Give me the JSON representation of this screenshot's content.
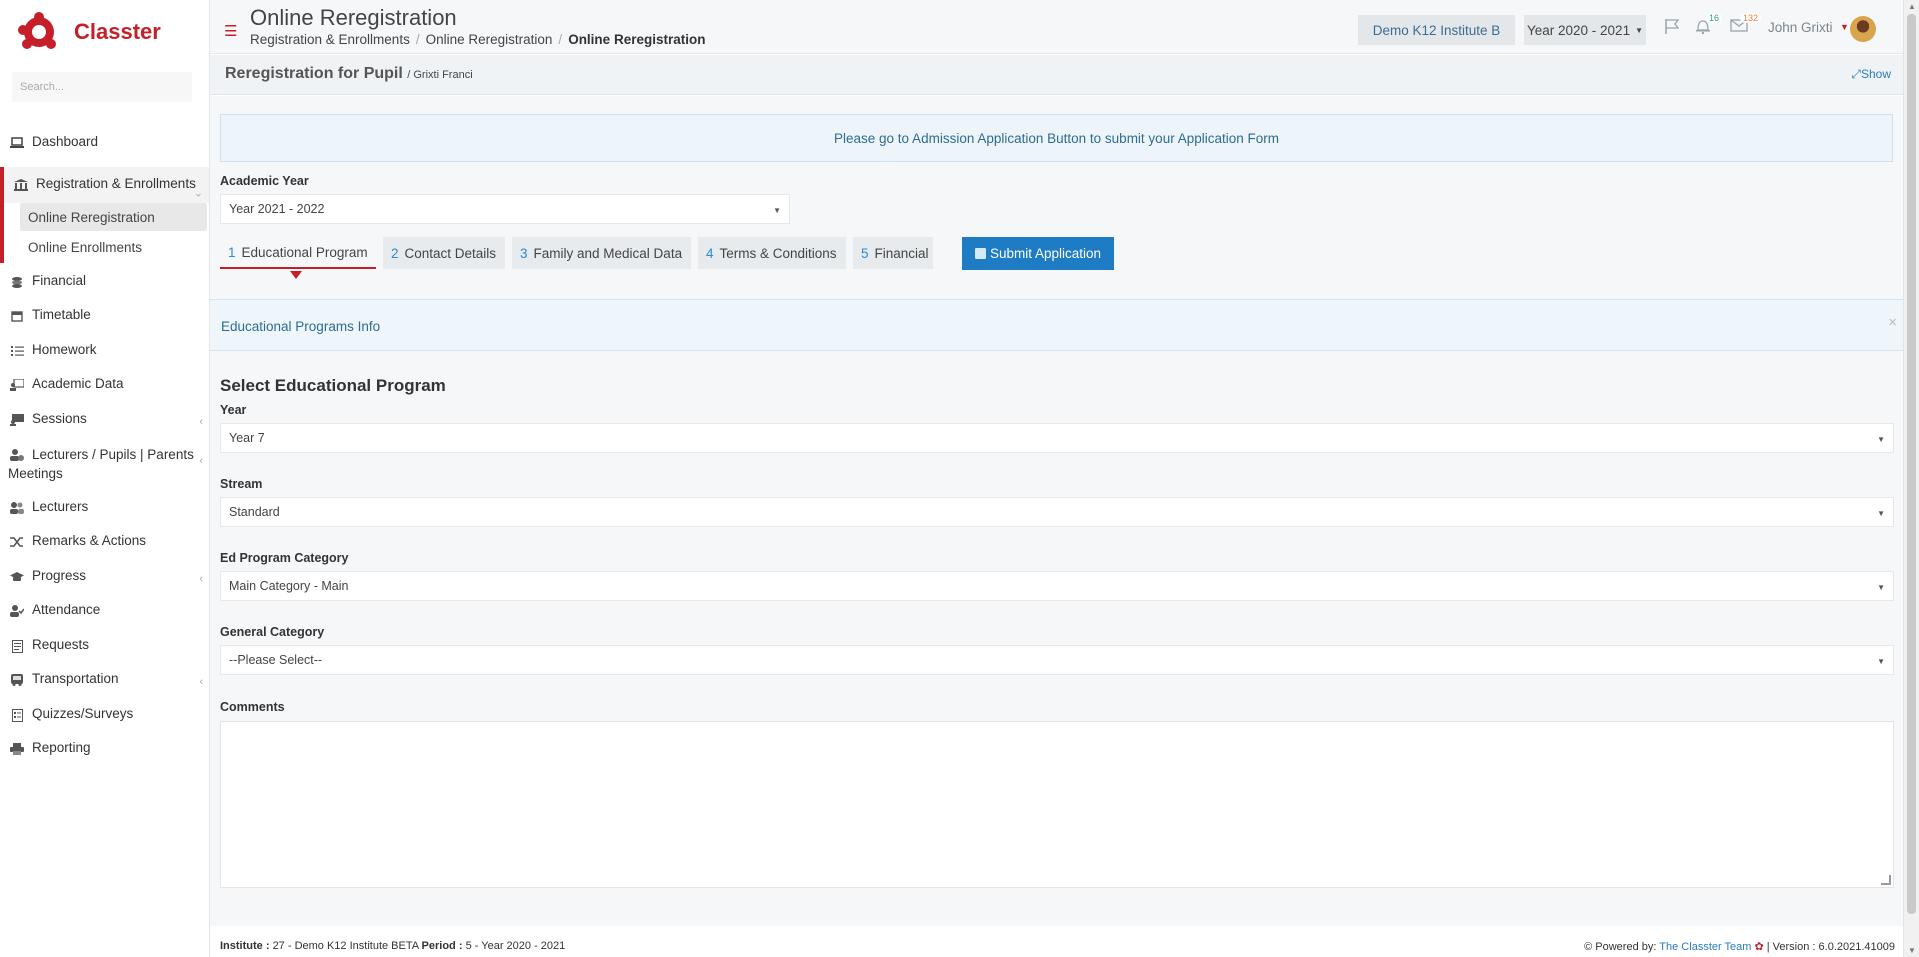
{
  "app": {
    "name": "Classter"
  },
  "sidebar": {
    "search_placeholder": "Search...",
    "items": [
      {
        "label": "Dashboard",
        "icon": "laptop-icon"
      },
      {
        "label": "Registration & Enrollments",
        "icon": "institution-icon"
      },
      {
        "label": "Financial",
        "icon": "coins-icon"
      },
      {
        "label": "Timetable",
        "icon": "calendar-icon"
      },
      {
        "label": "Homework",
        "icon": "list-icon"
      },
      {
        "label": "Academic Data",
        "icon": "chalkboard-user-icon"
      },
      {
        "label": "Sessions",
        "icon": "presentation-icon"
      },
      {
        "label": "Lecturers / Pupils | Parents Meetings",
        "icon": "user-clock-icon"
      },
      {
        "label": "Lecturers",
        "icon": "users-icon"
      },
      {
        "label": "Remarks & Actions",
        "icon": "shuffle-icon"
      },
      {
        "label": "Progress",
        "icon": "graduation-cap-icon"
      },
      {
        "label": "Attendance",
        "icon": "user-check-icon"
      },
      {
        "label": "Requests",
        "icon": "document-icon"
      },
      {
        "label": "Transportation",
        "icon": "bus-icon"
      },
      {
        "label": "Quizzes/Surveys",
        "icon": "checklist-icon"
      },
      {
        "label": "Reporting",
        "icon": "printer-icon"
      }
    ],
    "subitems": [
      {
        "label": "Online Reregistration"
      },
      {
        "label": "Online Enrollments"
      }
    ]
  },
  "header": {
    "title": "Online Reregistration",
    "breadcrumb": [
      "Registration & Enrollments",
      "Online Reregistration",
      "Online Reregistration"
    ],
    "institute": "Demo K12 Institute B",
    "year": "Year 2020 - 2021",
    "notifications_count": "16",
    "messages_count": "132",
    "user_name": "John Grixti"
  },
  "subheader": {
    "title": "Reregistration for Pupil",
    "pupil": "/ Grixti Franci",
    "show_label": "Show"
  },
  "main": {
    "info_alert": "Please go to Admission Application Button to submit your Application Form",
    "academic_year_label": "Academic Year",
    "academic_year_value": "Year 2021 - 2022",
    "tabs": [
      {
        "num": "1",
        "label": "Educational Program"
      },
      {
        "num": "2",
        "label": "Contact Details"
      },
      {
        "num": "3",
        "label": "Family and Medical Data"
      },
      {
        "num": "4",
        "label": "Terms & Conditions"
      },
      {
        "num": "5",
        "label": "Financial"
      }
    ],
    "submit_label": "Submit Application",
    "ed_info": "Educational Programs Info",
    "section_title": "Select Educational Program",
    "fields": {
      "year_label": "Year",
      "year_value": "Year 7",
      "stream_label": "Stream",
      "stream_value": "Standard",
      "category_label": "Ed Program Category",
      "category_value": "Main Category - Main",
      "general_label": "General Category",
      "general_value": "--Please Select--",
      "comments_label": "Comments"
    }
  },
  "footer": {
    "institute_label": "Institute :",
    "institute_value": "27 - Demo K12 Institute BETA",
    "period_label": "Period :",
    "period_value": "5 - Year 2020 - 2021",
    "powered_by": "Powered by:",
    "team": "The Classter Team",
    "version": "| Version : 6.0.2021.41009"
  },
  "colors": {
    "brand": "#c51f2a",
    "primary": "#1e7cc4",
    "link": "#2a7bbf"
  }
}
